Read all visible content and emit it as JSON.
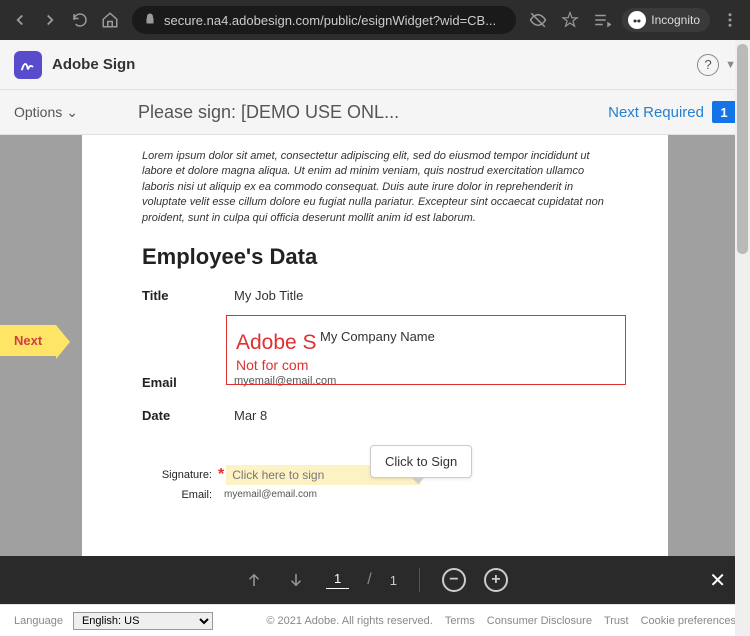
{
  "browser": {
    "url": "secure.na4.adobesign.com/public/esignWidget?wid=CB...",
    "incognito_label": "Incognito"
  },
  "header": {
    "app_name": "Adobe Sign"
  },
  "toolbar": {
    "options_label": "Options",
    "sign_prompt": "Please sign: [DEMO USE ONL...",
    "next_required": "Next Required",
    "count": "1"
  },
  "next_tab": "Next",
  "document": {
    "lorem": "Lorem ipsum dolor sit amet, consectetur adipiscing elit, sed do eiusmod tempor incididunt ut labore et dolore magna aliqua. Ut enim ad minim veniam, quis nostrud exercitation ullamco laboris nisi ut aliquip ex ea commodo consequat. Duis aute irure dolor in reprehenderit in voluptate velit esse cillum dolore eu fugiat nulla pariatur. Excepteur sint occaecat cupidatat non proident, sunt in culpa qui officia deserunt mollit anim id est laborum.",
    "section_title": "Employee's Data",
    "title_label": "Title",
    "title_value": "My Job Title",
    "company_value": "My Company Name",
    "watermark1": "Adobe S",
    "watermark2": "Not for com",
    "email_label": "Email",
    "email_value": "myemail@email.com",
    "date_label": "Date",
    "date_value": "Mar 8",
    "tooltip": "Click to Sign",
    "signature_label": "Signature:",
    "signature_placeholder": "Click here to sign",
    "sig_email_label": "Email:",
    "sig_email_value": "myemail@email.com"
  },
  "pager": {
    "current": "1",
    "sep": "/",
    "total": "1"
  },
  "footer": {
    "language_label": "Language",
    "language_value": "English: US",
    "copyright": "© 2021 Adobe. All rights reserved.",
    "terms": "Terms",
    "consumer": "Consumer Disclosure",
    "trust": "Trust",
    "cookie": "Cookie preferences"
  }
}
